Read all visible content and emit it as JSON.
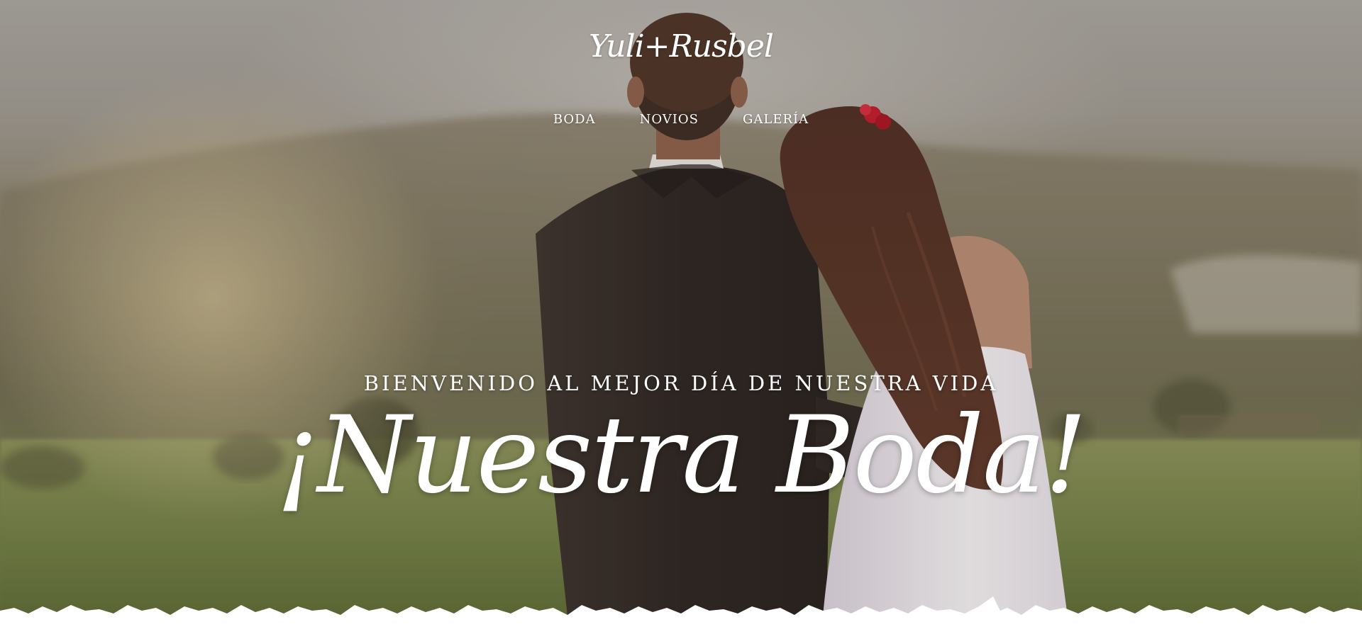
{
  "site": {
    "logo": "Yuli+Rusbel"
  },
  "nav": {
    "items": [
      {
        "label": "BODA"
      },
      {
        "label": "NOVIOS"
      },
      {
        "label": "GALERÍA"
      }
    ]
  },
  "hero": {
    "welcome": "BIENVENIDO AL MEJOR DÍA DE NUESTRA VIDA",
    "headline": "¡Nuestra Boda!"
  },
  "colors": {
    "text": "#ffffff",
    "suit": "#2e2521",
    "hair": "#4a2a1f",
    "dress": "#f2eff2",
    "grass": "#6e7b44",
    "flower": "#c0182a"
  }
}
